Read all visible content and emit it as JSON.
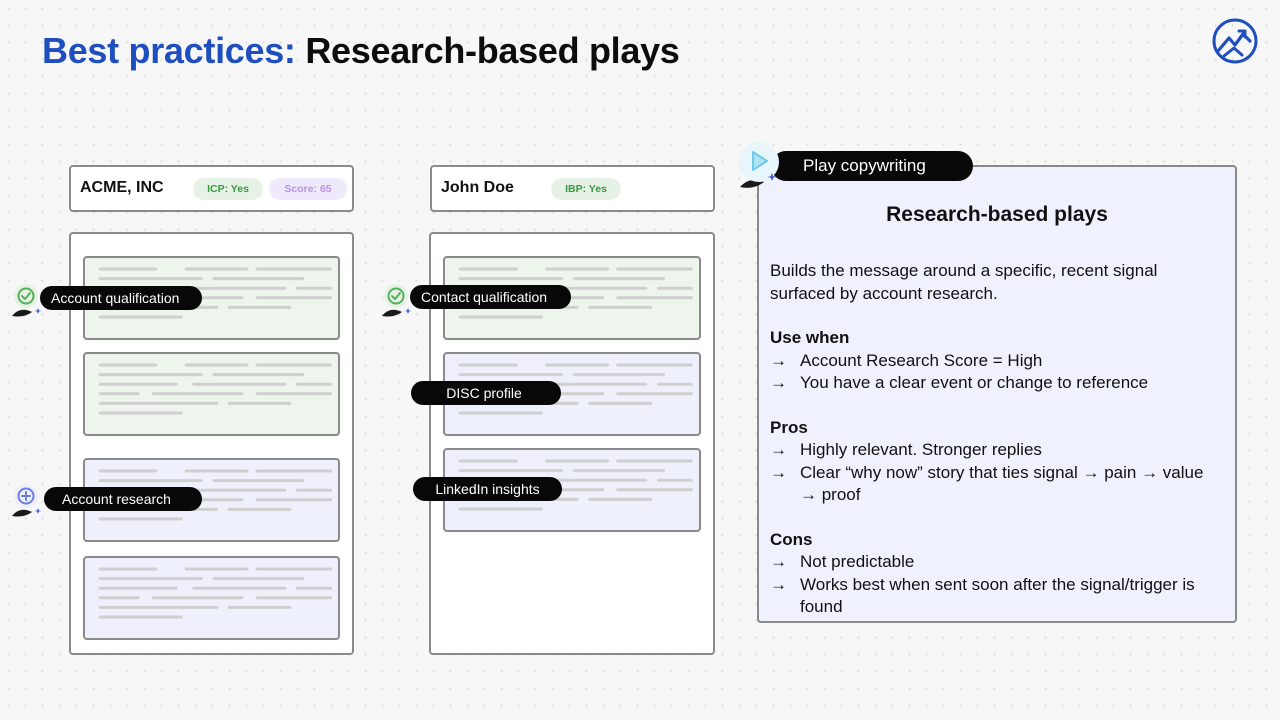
{
  "title": {
    "accent": "Best practices:",
    "rest": " Research-based plays"
  },
  "logo": {
    "icon": "mountain-peak-logo-icon"
  },
  "account_column": {
    "name": "ACME, INC",
    "badges": [
      {
        "label": "ICP: Yes",
        "color": "#3a9a3f"
      },
      {
        "label": "Score: 65",
        "color": "#b793e6"
      }
    ],
    "tags": [
      {
        "label": "Account qualification",
        "icon": "check-circle-icon"
      },
      {
        "label": "Account research",
        "icon": "plus-circle-icon"
      }
    ]
  },
  "contact_column": {
    "name": "John Doe",
    "badges": [
      {
        "label": "IBP: Yes",
        "color": "#3a9a3f"
      }
    ],
    "tags": [
      {
        "label": "Contact qualification",
        "icon": "check-circle-icon"
      },
      {
        "label": "DISC profile"
      },
      {
        "label": "LinkedIn insights"
      }
    ]
  },
  "play_panel": {
    "tab_label": "Play copywriting",
    "tab_icon": "play-triangle-icon",
    "heading": "Research-based plays",
    "intro": "Builds the message around a specific, recent signal surfaced by account research.",
    "sections": [
      {
        "title": "Use when",
        "items": [
          "Account Research Score = High",
          "You have a clear event or change to reference"
        ]
      },
      {
        "title": "Pros",
        "items": [
          "Highly relevant. Stronger replies",
          "Clear “why now” story that ties signal → pain → value → proof"
        ]
      },
      {
        "title": "Cons",
        "items": [
          "Not predictable",
          "Works best when sent soon after the signal/trigger is found"
        ]
      }
    ],
    "bullet_glyph": "→"
  },
  "colors": {
    "accent_blue": "#1f4fbf",
    "green_fill": "#eef5ec",
    "blue_fill": "#eef0fc",
    "panel_fill": "#eff1fd"
  }
}
